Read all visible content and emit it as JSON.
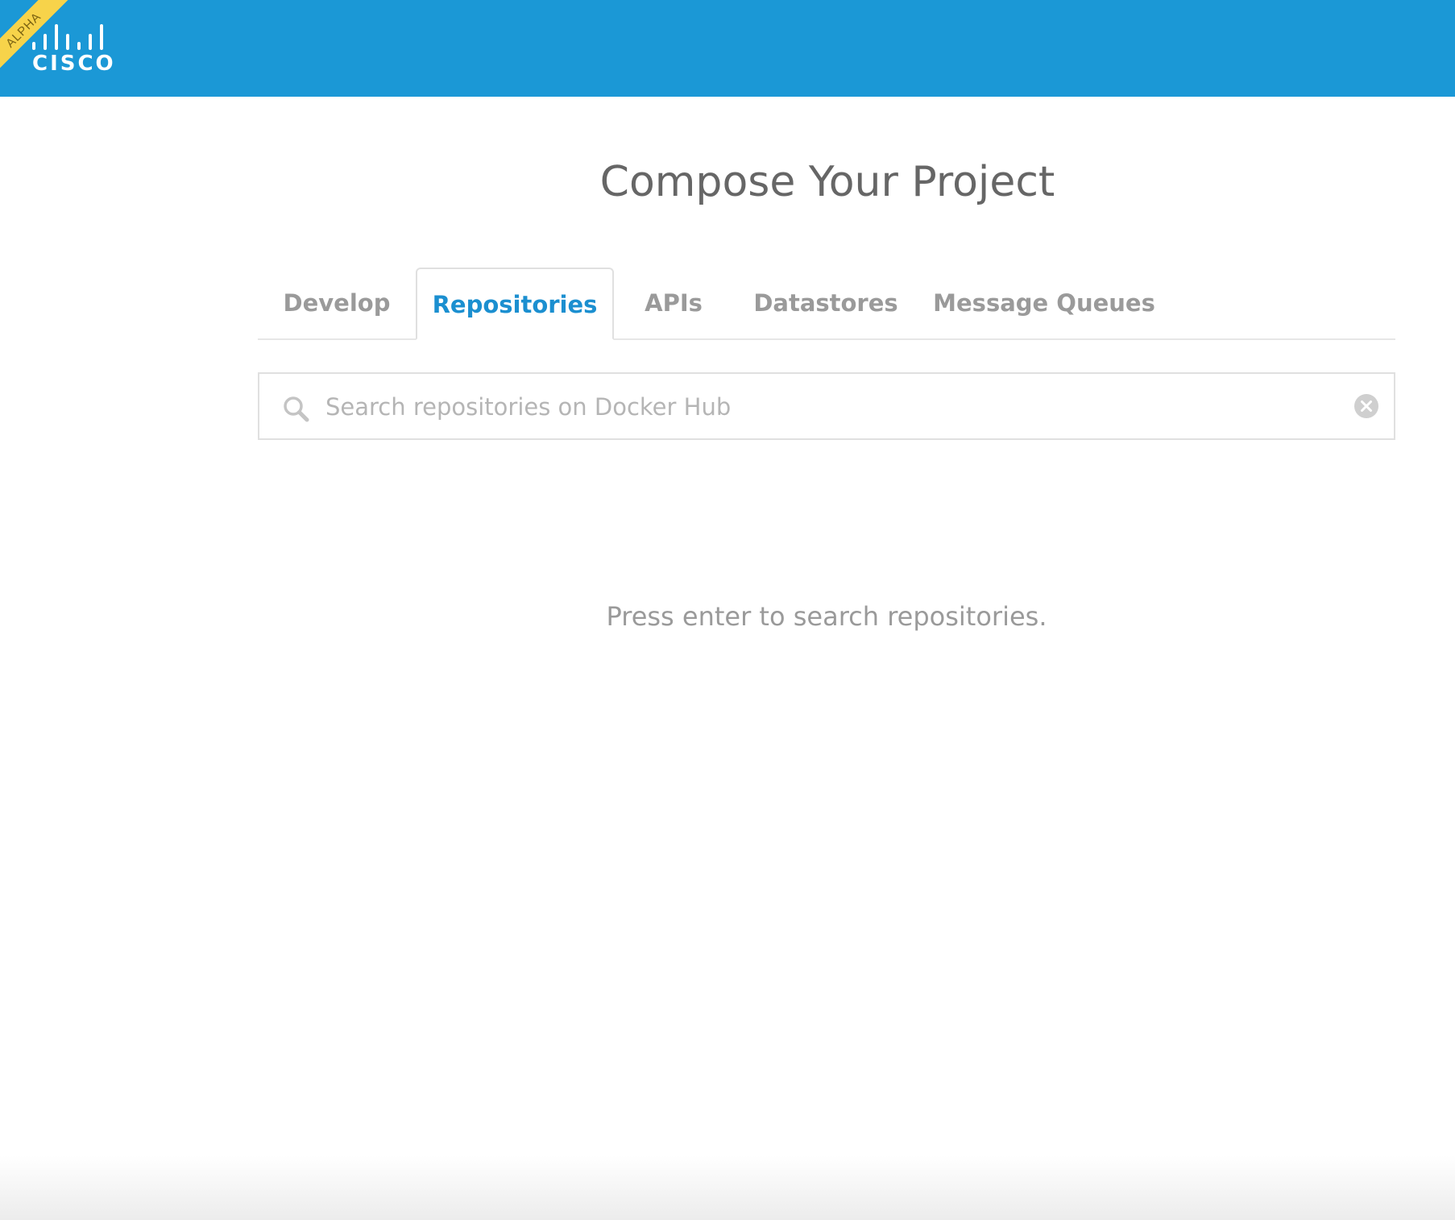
{
  "header": {
    "ribbon_label": "ALPHA",
    "logo_text": "CISCO",
    "brand_color": "#1b98d6",
    "ribbon_color": "#f7d34a"
  },
  "page": {
    "title": "Compose Your Project"
  },
  "tabs": {
    "active": "Repositories",
    "items": [
      {
        "label": "Develop"
      },
      {
        "label": "Repositories"
      },
      {
        "label": "APIs"
      },
      {
        "label": "Datastores"
      },
      {
        "label": "Message Queues"
      }
    ]
  },
  "search": {
    "placeholder": "Search repositories on Docker Hub",
    "value": "",
    "icon": "search-icon",
    "clear_icon": "clear-icon"
  },
  "results": {
    "hint": "Press enter to search repositories."
  },
  "colors": {
    "active_tab": "#1b8fd0",
    "inactive_tab": "#9a9a9a",
    "border": "#e0e0e0"
  }
}
